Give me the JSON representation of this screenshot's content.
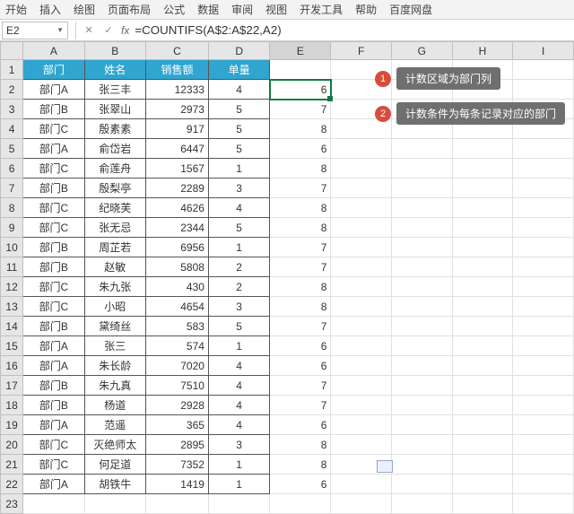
{
  "ribbon": {
    "tabs": [
      "开始",
      "插入",
      "绘图",
      "页面布局",
      "公式",
      "数据",
      "审阅",
      "视图",
      "开发工具",
      "帮助",
      "百度网盘"
    ]
  },
  "namebox": "E2",
  "formula": "=COUNTIFS(A$2:A$22,A2)",
  "columns": [
    "A",
    "B",
    "C",
    "D",
    "E",
    "F",
    "G",
    "H",
    "I"
  ],
  "headers": {
    "dept": "部门",
    "name": "姓名",
    "sales": "销售额",
    "qty": "单量"
  },
  "rows": [
    {
      "dept": "部门A",
      "name": "张三丰",
      "sales": "12333",
      "qty": "4",
      "cnt": "6"
    },
    {
      "dept": "部门B",
      "name": "张翠山",
      "sales": "2973",
      "qty": "5",
      "cnt": "7"
    },
    {
      "dept": "部门C",
      "name": "殷素素",
      "sales": "917",
      "qty": "5",
      "cnt": "8"
    },
    {
      "dept": "部门A",
      "name": "俞岱岩",
      "sales": "6447",
      "qty": "5",
      "cnt": "6"
    },
    {
      "dept": "部门C",
      "name": "俞莲舟",
      "sales": "1567",
      "qty": "1",
      "cnt": "8"
    },
    {
      "dept": "部门B",
      "name": "殷梨亭",
      "sales": "2289",
      "qty": "3",
      "cnt": "7"
    },
    {
      "dept": "部门C",
      "name": "纪晓芙",
      "sales": "4626",
      "qty": "4",
      "cnt": "8"
    },
    {
      "dept": "部门C",
      "name": "张无忌",
      "sales": "2344",
      "qty": "5",
      "cnt": "8"
    },
    {
      "dept": "部门B",
      "name": "周芷若",
      "sales": "6956",
      "qty": "1",
      "cnt": "7"
    },
    {
      "dept": "部门B",
      "name": "赵敏",
      "sales": "5808",
      "qty": "2",
      "cnt": "7"
    },
    {
      "dept": "部门C",
      "name": "朱九张",
      "sales": "430",
      "qty": "2",
      "cnt": "8"
    },
    {
      "dept": "部门C",
      "name": "小昭",
      "sales": "4654",
      "qty": "3",
      "cnt": "8"
    },
    {
      "dept": "部门B",
      "name": "黛绮丝",
      "sales": "583",
      "qty": "5",
      "cnt": "7"
    },
    {
      "dept": "部门A",
      "name": "张三",
      "sales": "574",
      "qty": "1",
      "cnt": "6"
    },
    {
      "dept": "部门A",
      "name": "朱长龄",
      "sales": "7020",
      "qty": "4",
      "cnt": "6"
    },
    {
      "dept": "部门B",
      "name": "朱九真",
      "sales": "7510",
      "qty": "4",
      "cnt": "7"
    },
    {
      "dept": "部门B",
      "name": "杨道",
      "sales": "2928",
      "qty": "4",
      "cnt": "7"
    },
    {
      "dept": "部门A",
      "name": "范遥",
      "sales": "365",
      "qty": "4",
      "cnt": "6"
    },
    {
      "dept": "部门C",
      "name": "灭绝师太",
      "sales": "2895",
      "qty": "3",
      "cnt": "8"
    },
    {
      "dept": "部门C",
      "name": "何足道",
      "sales": "7352",
      "qty": "1",
      "cnt": "8"
    },
    {
      "dept": "部门A",
      "name": "胡铁牛",
      "sales": "1419",
      "qty": "1",
      "cnt": "6"
    }
  ],
  "callouts": [
    {
      "n": "1",
      "text": "计数区域为部门列"
    },
    {
      "n": "2",
      "text": "计数条件为每条记录对应的部门"
    }
  ]
}
